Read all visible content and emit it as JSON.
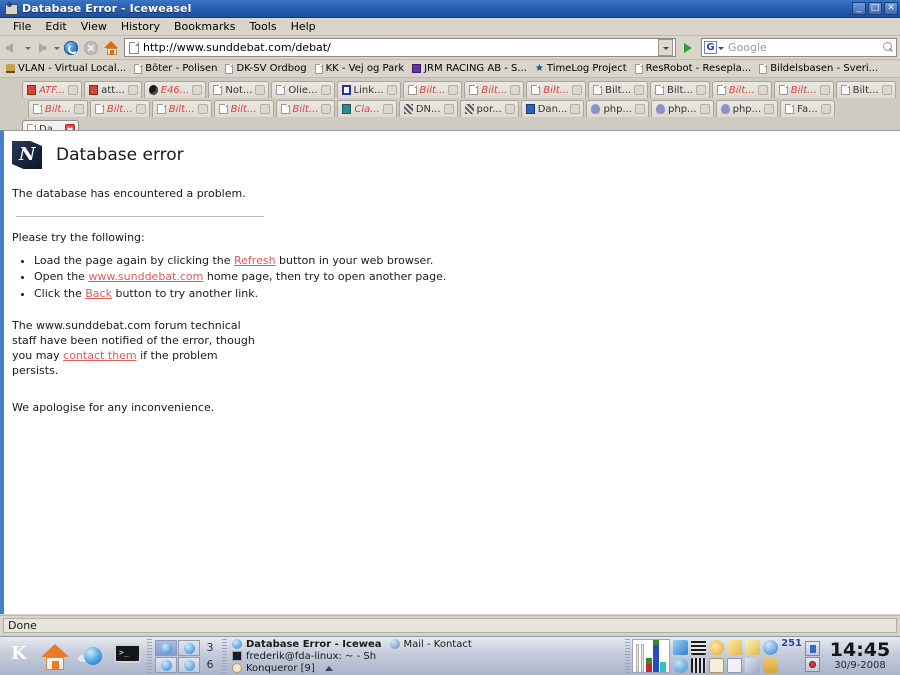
{
  "window": {
    "title": "Database Error - Iceweasel",
    "icon": "iceweasel-icon",
    "minimize_label": "_",
    "maximize_label": "□",
    "close_label": "✕"
  },
  "menu": {
    "items": [
      "File",
      "Edit",
      "View",
      "History",
      "Bookmarks",
      "Tools",
      "Help"
    ]
  },
  "toolbar": {
    "back_icon": "back-arrow-icon",
    "forward_icon": "forward-arrow-icon",
    "reload_icon": "reload-icon",
    "stop_icon": "stop-icon",
    "home_icon": "home-icon",
    "url": "http://www.sunddebat.com/debat/",
    "go_icon": "go-icon",
    "search_engine": "Google",
    "search_placeholder": "Google",
    "search_icon": "magnifier-icon"
  },
  "bookmarks": [
    {
      "label": "VLAN - Virtual Local...",
      "icon": "bookmark-icon"
    },
    {
      "label": "Böter - Polisen",
      "icon": "document-icon"
    },
    {
      "label": "DK-SV Ordbog",
      "icon": "document-icon"
    },
    {
      "label": "KK - Vej og Park",
      "icon": "document-icon"
    },
    {
      "label": "JRM RACING AB - S...",
      "icon": "purple-icon"
    },
    {
      "label": "TimeLog Project",
      "icon": "star-icon"
    },
    {
      "label": "ResRobot - Resepla...",
      "icon": "document-icon"
    },
    {
      "label": "Bildelsbasen - Sveri...",
      "icon": "document-icon"
    }
  ],
  "tabs_row1": [
    {
      "label": "ATF...",
      "icon": "red-icon",
      "style": "red"
    },
    {
      "label": "att...",
      "icon": "red-icon",
      "style": "normal"
    },
    {
      "label": "E46...",
      "icon": "globe-icon",
      "style": "red"
    },
    {
      "label": "Not...",
      "icon": "document-icon",
      "style": "normal"
    },
    {
      "label": "Olie...",
      "icon": "document-icon",
      "style": "normal"
    },
    {
      "label": "Link...",
      "icon": "blue-box-icon",
      "style": "normal"
    },
    {
      "label": "Bilt...",
      "icon": "document-icon",
      "style": "red"
    },
    {
      "label": "Bilt...",
      "icon": "document-icon",
      "style": "red"
    },
    {
      "label": "Bilt...",
      "icon": "document-icon",
      "style": "red"
    },
    {
      "label": "Bilt...",
      "icon": "document-icon",
      "style": "normal"
    },
    {
      "label": "Bilt...",
      "icon": "document-icon",
      "style": "normal"
    },
    {
      "label": "Bilt...",
      "icon": "document-icon",
      "style": "red"
    },
    {
      "label": "Bilt...",
      "icon": "document-icon",
      "style": "red"
    },
    {
      "label": "Bilt...",
      "icon": "document-icon",
      "style": "normal"
    }
  ],
  "tabs_row2": [
    {
      "label": "Bilt...",
      "icon": "document-icon",
      "style": "red"
    },
    {
      "label": "Bilt...",
      "icon": "document-icon",
      "style": "red"
    },
    {
      "label": "Bilt...",
      "icon": "document-icon",
      "style": "red"
    },
    {
      "label": "Bilt...",
      "icon": "document-icon",
      "style": "red"
    },
    {
      "label": "Bilt...",
      "icon": "document-icon",
      "style": "red"
    },
    {
      "label": "Cla...",
      "icon": "teal-icon",
      "style": "red"
    },
    {
      "label": "DN...",
      "icon": "dn-icon",
      "style": "normal"
    },
    {
      "label": "por...",
      "icon": "dn-icon",
      "style": "normal"
    },
    {
      "label": "Dan...",
      "icon": "dan-icon",
      "style": "normal"
    },
    {
      "label": "php...",
      "icon": "php-icon",
      "style": "normal"
    },
    {
      "label": "php...",
      "icon": "php-icon",
      "style": "normal"
    },
    {
      "label": "php...",
      "icon": "php-icon",
      "style": "normal"
    },
    {
      "label": "Fa...",
      "icon": "document-icon",
      "style": "normal"
    }
  ],
  "active_tab": {
    "label": "Da...",
    "icon": "document-icon",
    "close_label": "✕"
  },
  "page": {
    "title": "Database error",
    "logo": "database-error-logo",
    "intro": "The database has encountered a problem.",
    "please_try": "Please try the following:",
    "bullets": [
      {
        "pre": "Load the page again by clicking the ",
        "link": "Refresh",
        "post": " button in your web browser."
      },
      {
        "pre": "Open the ",
        "link": "www.sunddebat.com",
        "post": " home page, then try to open another page."
      },
      {
        "pre": "Click the ",
        "link": "Back",
        "post": " button to try another link."
      }
    ],
    "notice_pre": "The www.sunddebat.com forum technical staff have been notified of the error, though you may ",
    "notice_link": "contact them",
    "notice_post": " if the problem persists.",
    "apology": "We apologise for any inconvenience."
  },
  "statusbar": {
    "text": "Done"
  },
  "panel": {
    "launchers": [
      {
        "name": "k-menu",
        "label": "K"
      },
      {
        "name": "home-launcher",
        "label": ""
      },
      {
        "name": "browser-launcher",
        "label": ""
      },
      {
        "name": "terminal-launcher",
        "label": ""
      }
    ],
    "pager": {
      "row1_label": "3",
      "row2_label": "6",
      "active_desktop": 1
    },
    "tasks": [
      {
        "label": "Database Error - Icewea",
        "icon": "iceweasel-icon",
        "bold": true
      },
      {
        "label": "Mail - Kontact",
        "icon": "mail-icon",
        "bold": false
      },
      {
        "label": "frederik@fda-linux: ~ - Sh",
        "icon": "terminal-icon",
        "bold": false
      },
      {
        "label": "Konqueror [9]",
        "icon": "konqueror-icon",
        "bold": false
      }
    ],
    "tray_badge": "251",
    "clock_time": "14:45",
    "clock_date": "30/9-2008"
  },
  "colors": {
    "titlebar": "#2a5fb0",
    "toolbar": "#d9d5cb",
    "page_bg": "#ffffff",
    "link": "#e05a5a",
    "panel": "#c8cedd",
    "accent_border": "#4a7fc9"
  }
}
